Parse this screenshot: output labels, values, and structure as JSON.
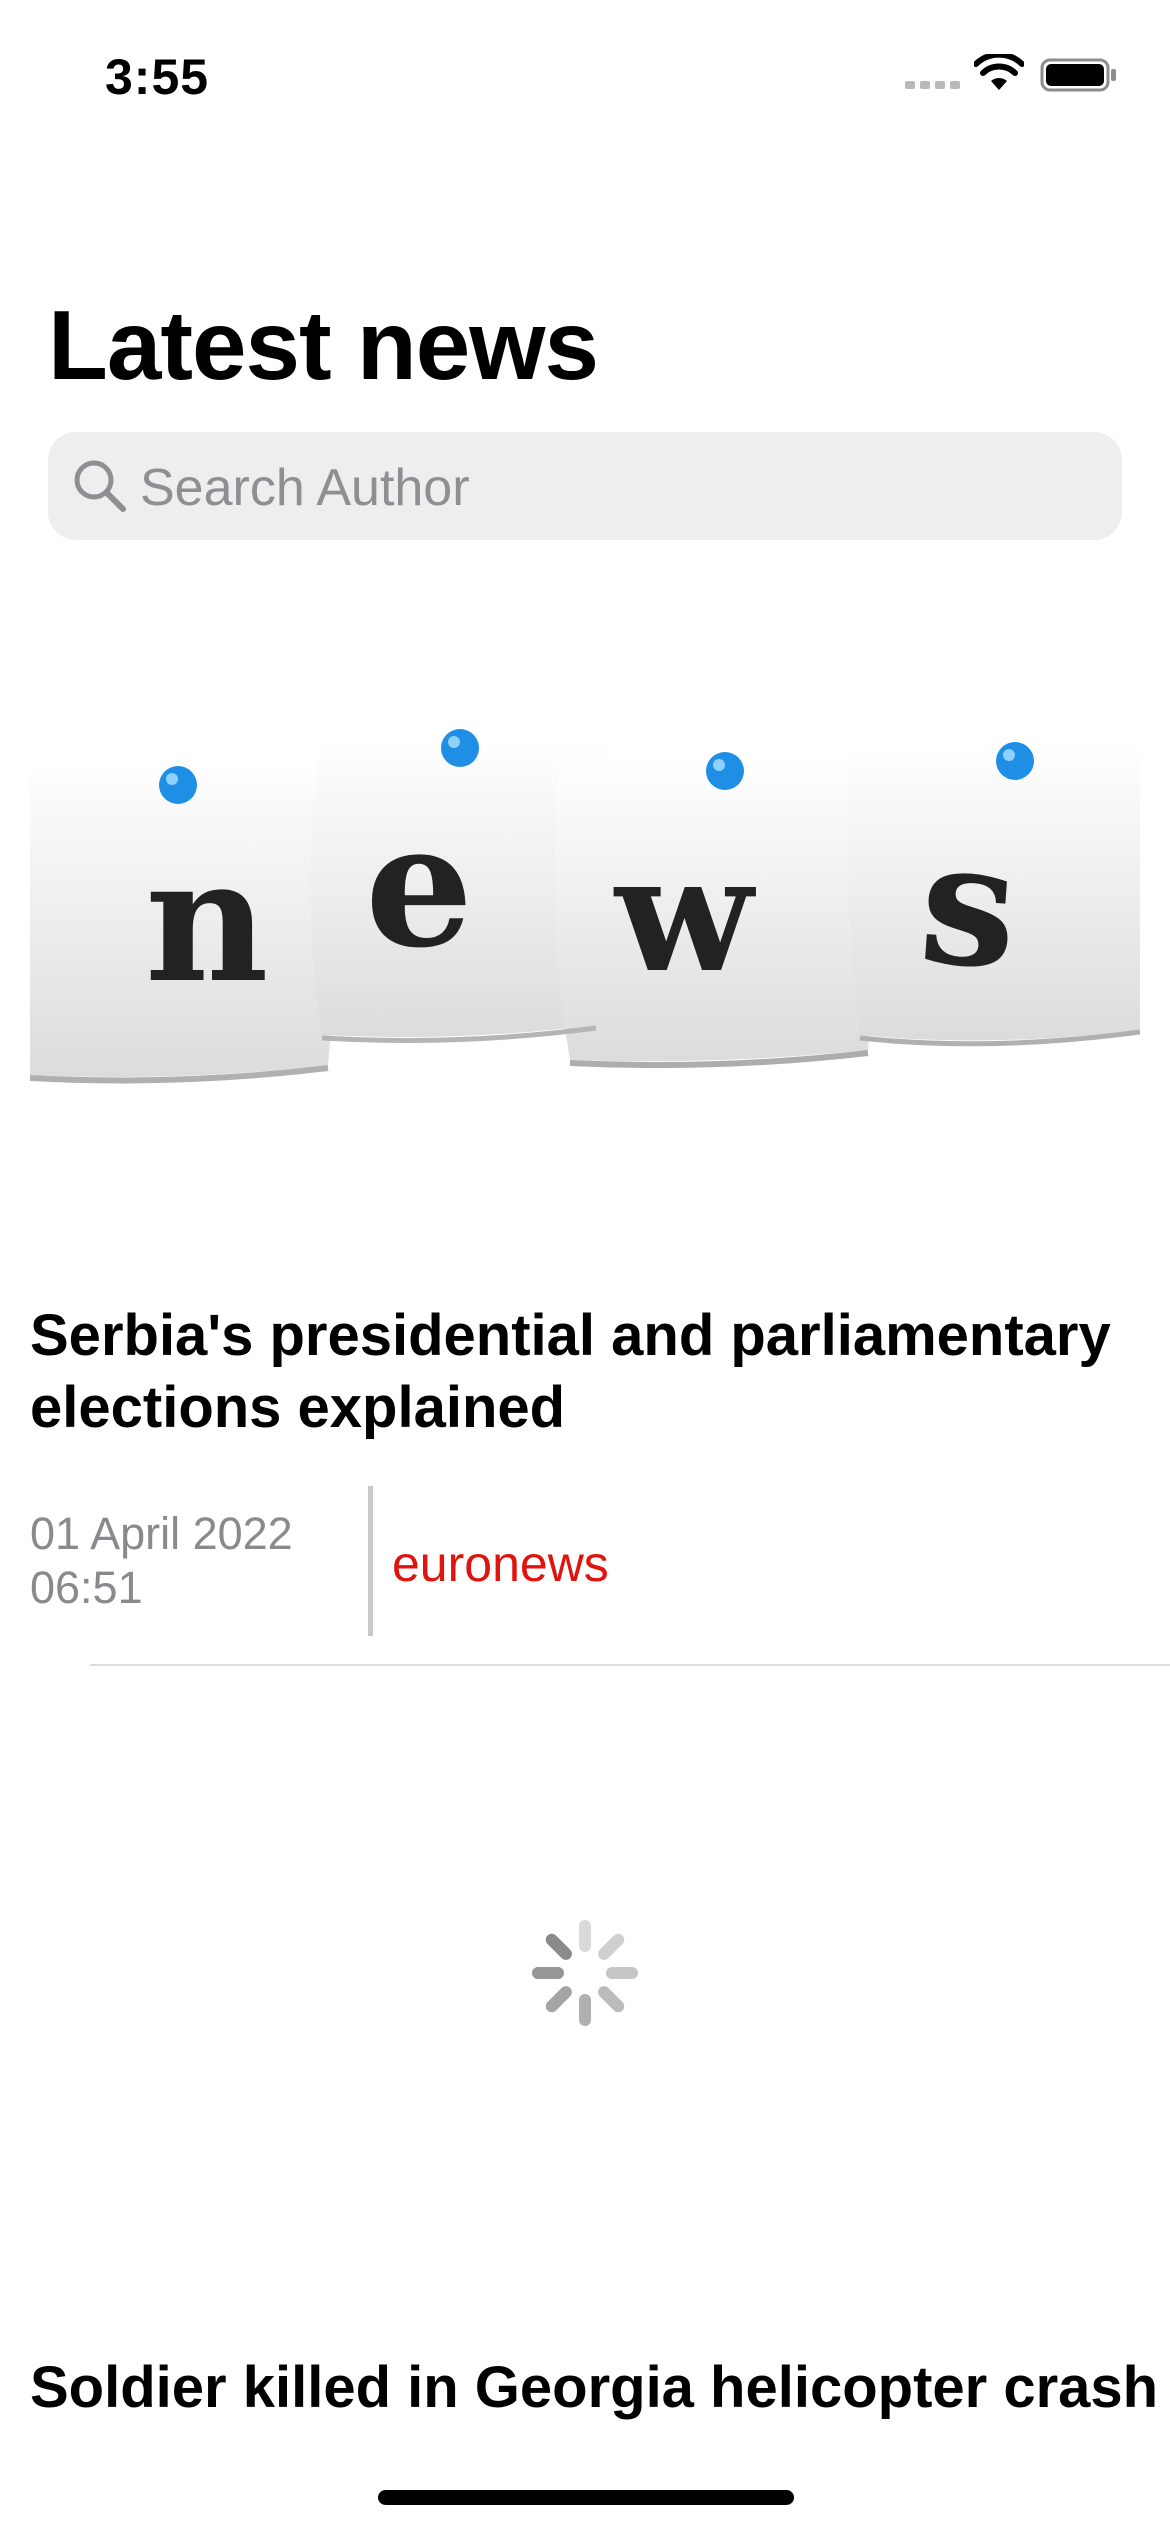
{
  "status_bar": {
    "time": "3:55"
  },
  "header": {
    "title": "Latest news"
  },
  "search": {
    "placeholder": "Search Author"
  },
  "articles": [
    {
      "image_text": "news",
      "title": "Serbia's presidential and parliamentary elections explained",
      "date": "01 April 2022",
      "time": "06:51",
      "source": "euronews"
    },
    {
      "title": "Soldier killed in Georgia helicopter crash"
    }
  ],
  "colors": {
    "source_accent": "#e0140d",
    "search_background": "#eeeeef",
    "pin_blue": "#1f8fe6"
  },
  "icons": [
    "signal-icon",
    "wifi-icon",
    "battery-icon",
    "search-icon",
    "loading-spinner"
  ]
}
